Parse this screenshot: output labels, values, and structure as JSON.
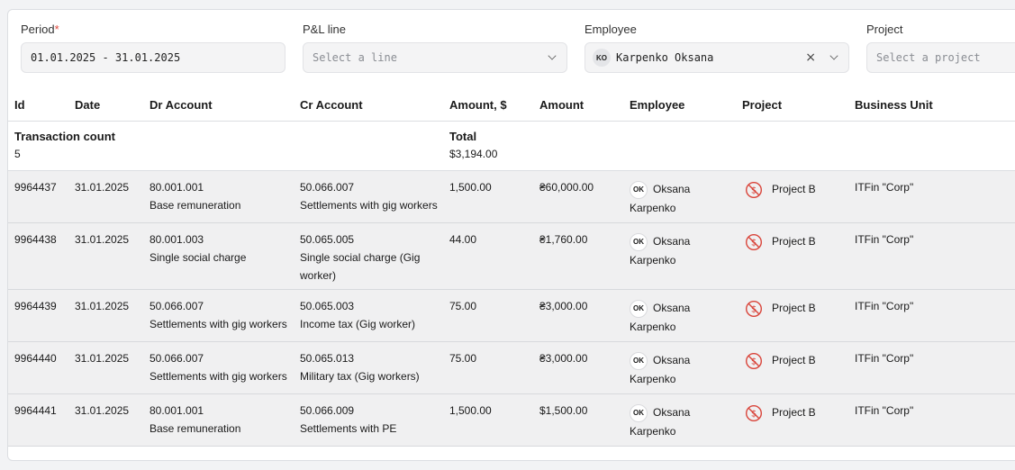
{
  "filters": {
    "period": {
      "label": "Period",
      "required_mark": "*",
      "value": "01.01.2025 - 31.01.2025"
    },
    "pl_line": {
      "label": "P&L line",
      "placeholder": "Select a line"
    },
    "employee": {
      "label": "Employee",
      "initials": "KO",
      "value": "Karpenko Oksana",
      "clear": "×"
    },
    "project": {
      "label": "Project",
      "placeholder": "Select a project"
    }
  },
  "columns": [
    "Id",
    "Date",
    "Dr Account",
    "Cr Account",
    "Amount, $",
    "Amount",
    "Employee",
    "Project",
    "Business Unit"
  ],
  "summary": {
    "count_label": "Transaction count",
    "count_value": "5",
    "total_label": "Total",
    "total_value": "$3,194.00"
  },
  "rows": [
    {
      "id": "9964437",
      "date": "31.01.2025",
      "dr_code": "80.001.001",
      "dr_name": "Base remuneration",
      "cr_code": "50.066.007",
      "cr_name": "Settlements with gig workers",
      "amount_usd": "1,500.00",
      "amount": "₴60,000.00",
      "emp_initials": "OK",
      "emp_first": "Oksana",
      "emp_last": "Karpenko",
      "project": "Project B",
      "bu": "ITFin \"Corp\""
    },
    {
      "id": "9964438",
      "date": "31.01.2025",
      "dr_code": "80.001.003",
      "dr_name": "Single social charge",
      "cr_code": "50.065.005",
      "cr_name": "Single social charge (Gig worker)",
      "amount_usd": "44.00",
      "amount": "₴1,760.00",
      "emp_initials": "OK",
      "emp_first": "Oksana",
      "emp_last": "Karpenko",
      "project": "Project B",
      "bu": "ITFin \"Corp\""
    },
    {
      "id": "9964439",
      "date": "31.01.2025",
      "dr_code": "50.066.007",
      "dr_name": "Settlements with gig workers",
      "cr_code": "50.065.003",
      "cr_name": "Income tax (Gig worker)",
      "amount_usd": "75.00",
      "amount": "₴3,000.00",
      "emp_initials": "OK",
      "emp_first": "Oksana",
      "emp_last": "Karpenko",
      "project": "Project B",
      "bu": "ITFin \"Corp\""
    },
    {
      "id": "9964440",
      "date": "31.01.2025",
      "dr_code": "50.066.007",
      "dr_name": "Settlements with gig workers",
      "cr_code": "50.065.013",
      "cr_name": "Military tax (Gig workers)",
      "amount_usd": "75.00",
      "amount": "₴3,000.00",
      "emp_initials": "OK",
      "emp_first": "Oksana",
      "emp_last": "Karpenko",
      "project": "Project B",
      "bu": "ITFin \"Corp\""
    },
    {
      "id": "9964441",
      "date": "31.01.2025",
      "dr_code": "80.001.001",
      "dr_name": "Base remuneration",
      "cr_code": "50.066.009",
      "cr_name": "Settlements with PE",
      "amount_usd": "1,500.00",
      "amount": "$1,500.00",
      "emp_initials": "OK",
      "emp_first": "Oksana",
      "emp_last": "Karpenko",
      "project": "Project B",
      "bu": "ITFin \"Corp\""
    }
  ],
  "colors": {
    "project_icon": "#d9443a",
    "row_bg": "#f0f0f1",
    "required": "#e0483b"
  },
  "icons": {
    "project": "no-money-icon",
    "dropdown": "chevron-down-icon",
    "clear": "close-icon"
  }
}
